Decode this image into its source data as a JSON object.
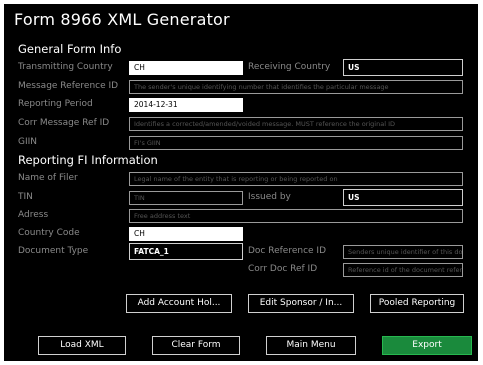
{
  "title": "Form 8966 XML Generator",
  "general": {
    "heading": "General Form Info",
    "transmitting_country": {
      "label": "Transmitting Country",
      "value": "CH"
    },
    "receiving_country": {
      "label": "Receiving Country",
      "value": "US"
    },
    "message_ref": {
      "label": "Message Reference ID",
      "placeholder": "The sender's unique identifying number that identifies the particular message"
    },
    "reporting_period": {
      "label": "Reporting Period",
      "value": "2014-12-31"
    },
    "corr_message_ref": {
      "label": "Corr Message Ref ID",
      "placeholder": "Identifies a corrected/amended/voided message. MUST reference the original ID"
    },
    "giin": {
      "label": "GIIN",
      "placeholder": "FI's GIIN"
    }
  },
  "reporting_fi": {
    "heading": "Reporting FI Information",
    "name_of_filer": {
      "label": "Name of Filer",
      "placeholder": "Legal name of the entity that is reporting or being reported on"
    },
    "tin": {
      "label": "TIN",
      "placeholder": "TIN"
    },
    "issued_by": {
      "label": "Issued by",
      "value": "US"
    },
    "address": {
      "label": "Adress",
      "placeholder": "Free address text"
    },
    "country_code": {
      "label": "Country Code",
      "value": "CH"
    },
    "document_type": {
      "label": "Document Type",
      "value": "FATCA_1"
    },
    "doc_ref_id": {
      "label": "Doc Reference ID",
      "placeholder": "Senders unique identifier of this do"
    },
    "corr_doc_ref_id": {
      "label": "Corr Doc Ref ID",
      "placeholder": "Reference id of the document refer"
    }
  },
  "actions": {
    "add_account": "Add Account Hol...",
    "edit_sponsor": "Edit Sponsor / In...",
    "pooled_reporting": "Pooled Reporting"
  },
  "footer": {
    "load_xml": "Load XML",
    "clear_form": "Clear Form",
    "main_menu": "Main Menu",
    "export": "Export"
  },
  "colors": {
    "background": "#000000",
    "export_button": "#1a8a3c"
  }
}
